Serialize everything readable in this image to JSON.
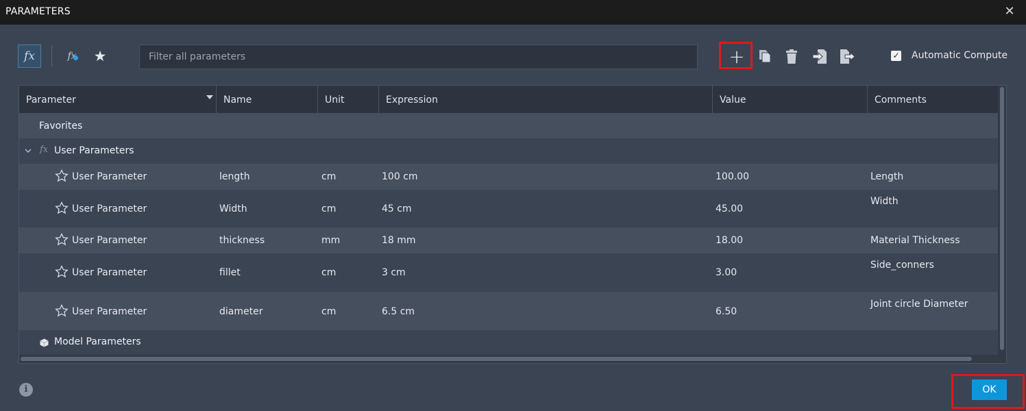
{
  "window": {
    "title": "PARAMETERS",
    "close_glyph": "✕"
  },
  "toolbar": {
    "fx_glyph": "fx",
    "filter_placeholder": "Filter all parameters",
    "add_glyph": "+",
    "automatic_compute_label": "Automatic Compute",
    "automatic_compute_checked": true
  },
  "columns": [
    "Parameter",
    "Name",
    "Unit",
    "Expression",
    "Value",
    "Comments"
  ],
  "groups": {
    "favorites": "Favorites",
    "user_parameters": "User Parameters",
    "model_parameters": "Model Parameters"
  },
  "rows": [
    {
      "parameter": "User Parameter",
      "name": "length",
      "unit": "cm",
      "expression": "100 cm",
      "value": "100.00",
      "comment": "Length"
    },
    {
      "parameter": "User Parameter",
      "name": "Width",
      "unit": "cm",
      "expression": "45 cm",
      "value": "45.00",
      "comment": "Width"
    },
    {
      "parameter": "User Parameter",
      "name": "thickness",
      "unit": "mm",
      "expression": "18 mm",
      "value": "18.00",
      "comment": "Material Thickness"
    },
    {
      "parameter": "User Parameter",
      "name": "fillet",
      "unit": "cm",
      "expression": "3 cm",
      "value": "3.00",
      "comment": "Side_conners"
    },
    {
      "parameter": "User Parameter",
      "name": "diameter",
      "unit": "cm",
      "expression": "6.5 cm",
      "value": "6.50",
      "comment": "Joint circle Diameter"
    }
  ],
  "footer": {
    "ok_label": "OK",
    "info_glyph": "i"
  },
  "colors": {
    "accent": "#0f96d9",
    "highlight": "#e01919",
    "background": "#3b4453",
    "titlebar": "#1c1c1c"
  }
}
